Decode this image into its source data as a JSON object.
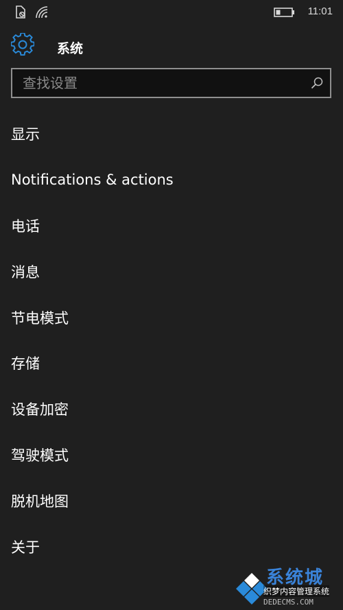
{
  "status_bar": {
    "time": "11:01",
    "icons": [
      "sim-off-icon",
      "wifi-icon",
      "battery-icon"
    ]
  },
  "header": {
    "icon": "gear-icon",
    "title": "系统"
  },
  "search": {
    "placeholder": "查找设置",
    "value": "",
    "icon": "search-icon"
  },
  "menu": {
    "items": [
      {
        "label": "显示"
      },
      {
        "label": "Notifications & actions"
      },
      {
        "label": "电话"
      },
      {
        "label": "消息"
      },
      {
        "label": "节电模式"
      },
      {
        "label": "存储"
      },
      {
        "label": "设备加密"
      },
      {
        "label": "驾驶模式"
      },
      {
        "label": "脱机地图"
      },
      {
        "label": "关于"
      }
    ]
  },
  "watermark": {
    "title": "系统城",
    "subtitle": "织梦内容管理系统",
    "domain": "DEDECMS.COM"
  },
  "colors": {
    "background": "#1f1f1f",
    "accent": "#2a8ad9",
    "text": "#ffffff",
    "placeholder": "#8a8a8a",
    "search_border": "#8f8f8f"
  }
}
